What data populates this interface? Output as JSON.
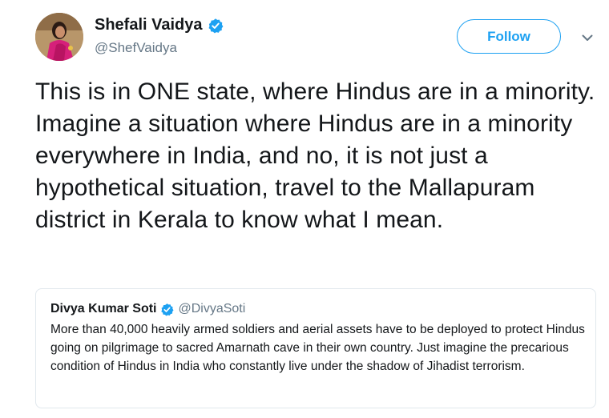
{
  "author": {
    "display_name": "Shefali Vaidya",
    "handle": "@ShefVaidya",
    "verified": true
  },
  "follow_button": {
    "label": "Follow"
  },
  "tweet": {
    "text": "This is in ONE state, where Hindus are in a minority. Imagine a situation where Hindus are in a minority everywhere in India, and no, it is not just a hypothetical situation, travel to the Mallapuram district in Kerala to know what I mean."
  },
  "quoted_tweet": {
    "display_name": "Divya Kumar Soti",
    "handle": "@DivyaSoti",
    "verified": true,
    "text": "More than 40,000 heavily armed soldiers and aerial assets have to be deployed to protect Hindus going on pilgrimage to sacred Amarnath cave in their own country. Just imagine the precarious condition of Hindus in India who constantly live under the shadow of Jihadist terrorism."
  },
  "colors": {
    "accent": "#1da1f2",
    "secondary_text": "#657786",
    "primary_text": "#14171a",
    "border": "#e1e8ed"
  },
  "icons": {
    "verified": "verified-badge-icon",
    "menu": "chevron-down-icon"
  }
}
